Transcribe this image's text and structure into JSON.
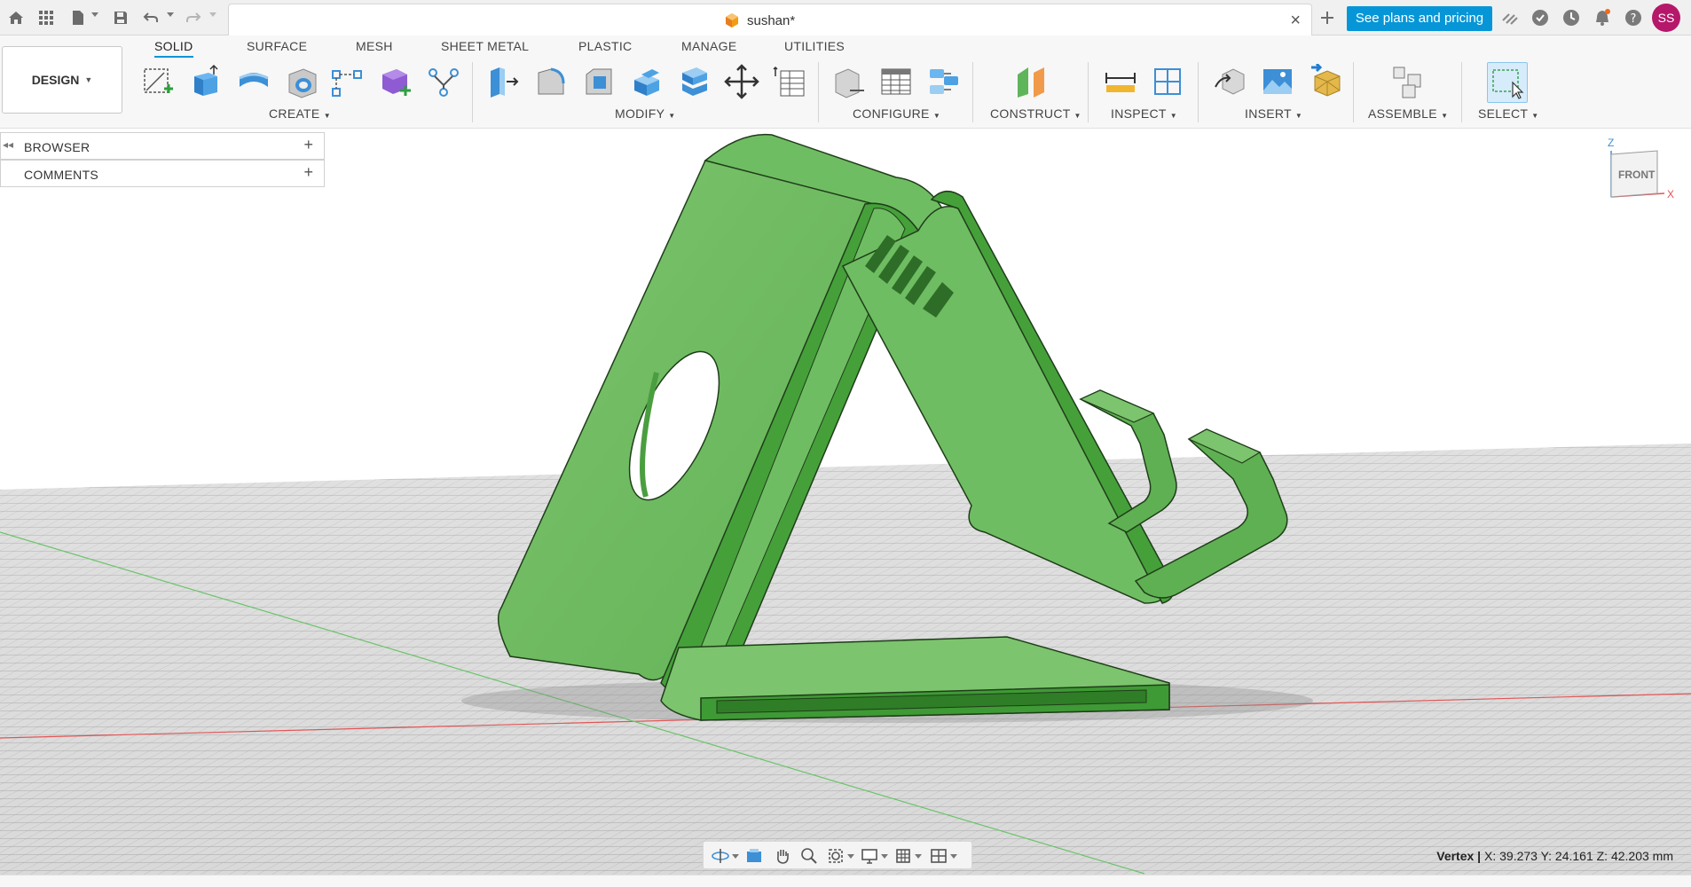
{
  "topbar": {
    "document_title": "sushan*",
    "plans_button": "See plans and pricing",
    "user_initials": "SS"
  },
  "ribbon": {
    "workspace": "DESIGN",
    "tabs": [
      "SOLID",
      "SURFACE",
      "MESH",
      "SHEET METAL",
      "PLASTIC",
      "MANAGE",
      "UTILITIES"
    ],
    "active_tab": "SOLID",
    "groups": {
      "create": "CREATE",
      "modify": "MODIFY",
      "configure": "CONFIGURE",
      "construct": "CONSTRUCT",
      "inspect": "INSPECT",
      "insert": "INSERT",
      "assemble": "ASSEMBLE",
      "select": "SELECT"
    }
  },
  "panels": {
    "browser": "BROWSER",
    "comments": "COMMENTS"
  },
  "viewcube": {
    "face": "FRONT",
    "axis_z": "Z",
    "axis_x": "X"
  },
  "status": {
    "selection_type": "Vertex",
    "coordinates": "X: 39.273 Y: 24.161 Z: 42.203 mm"
  },
  "colors": {
    "accent": "#0696d7",
    "model_green": "#6dbb5f",
    "model_edge_green": "#3f9a37",
    "avatar": "#b5176a"
  }
}
